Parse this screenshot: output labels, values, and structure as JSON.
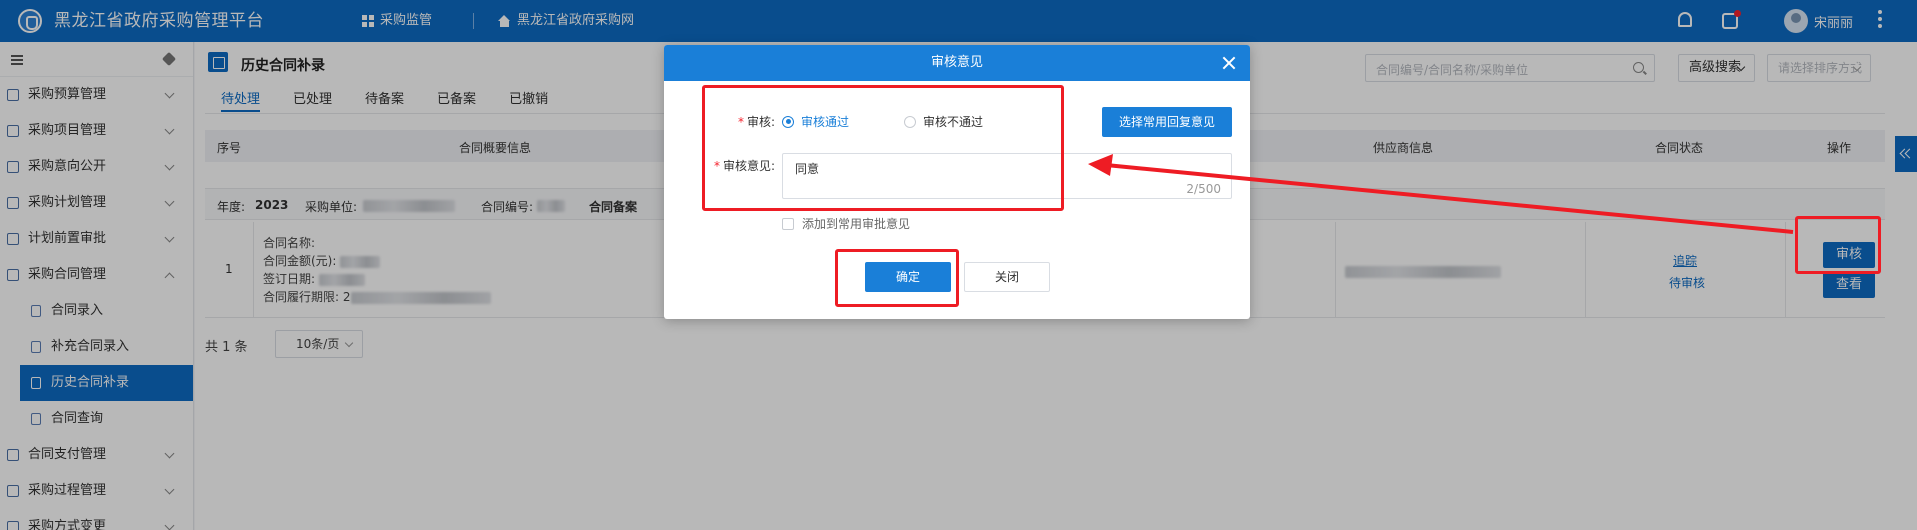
{
  "app": {
    "title": "黑龙江省政府采购管理平台"
  },
  "topnav": {
    "items": [
      "采购监管",
      "黑龙江省政府采购网"
    ]
  },
  "user": {
    "name": "宋丽丽"
  },
  "sidebar": {
    "items": [
      {
        "label": "采购预算管理",
        "expand": "down"
      },
      {
        "label": "采购项目管理",
        "expand": "down"
      },
      {
        "label": "采购意向公开",
        "expand": "down"
      },
      {
        "label": "采购计划管理",
        "expand": "down"
      },
      {
        "label": "计划前置审批",
        "expand": "down"
      },
      {
        "label": "采购合同管理",
        "expand": "up"
      },
      {
        "label": "合同录入",
        "sub": true
      },
      {
        "label": "补充合同录入",
        "sub": true
      },
      {
        "label": "历史合同补录",
        "sub": true,
        "active": true
      },
      {
        "label": "合同查询",
        "sub": true
      },
      {
        "label": "合同支付管理",
        "expand": "down"
      },
      {
        "label": "采购过程管理",
        "expand": "down"
      },
      {
        "label": "采购方式变更",
        "expand": "down"
      }
    ]
  },
  "page": {
    "title": "历史合同补录",
    "tabs": [
      "待处理",
      "已处理",
      "待备案",
      "已备案",
      "已撤销"
    ],
    "search_placeholder": "合同编号/合同名称/采购单位",
    "advanced_search": "高级搜索",
    "sort_placeholder": "请选择排序方式"
  },
  "table": {
    "headers": {
      "no": "序号",
      "summary": "合同概要信息",
      "supplier": "供应商信息",
      "status": "合同状态",
      "op": "操作"
    },
    "group": {
      "year_label": "年度:",
      "year": "2023",
      "unit_label": "采购单位:",
      "code_label": "合同编号:",
      "tag": "合同备案"
    },
    "row": {
      "no": "1",
      "name_label": "合同名称:",
      "amount_label": "合同金额(元):",
      "sign_label": "签订日期:",
      "period_label": "合同履行期限:",
      "period_prefix": "2",
      "track": "追踪",
      "status": "待审核",
      "btn_review": "审核",
      "btn_view": "查看"
    }
  },
  "pagination": {
    "total": "共 1 条",
    "page_size": "10条/页"
  },
  "dialog": {
    "title": "审核意见",
    "review_label": "审核:",
    "options": [
      "审核通过",
      "审核不通过"
    ],
    "selected": 0,
    "pick_btn": "选择常用回复意见",
    "opinion_label": "审核意见:",
    "opinion_value": "同意",
    "counter": "2/500",
    "add_common": "添加到常用审批意见",
    "confirm": "确定",
    "close": "关闭"
  },
  "colors": {
    "primary": "#0d6bc4",
    "dialog_head": "#1a7fd8",
    "annotation": "#ee1c24"
  }
}
